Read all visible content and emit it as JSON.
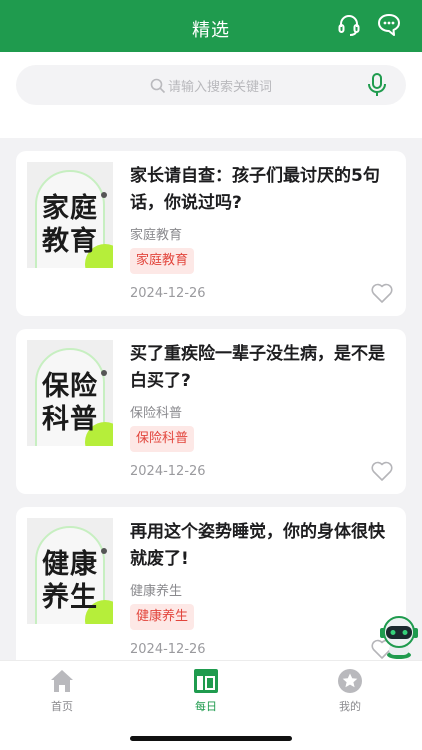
{
  "header": {
    "title": "精选",
    "icons": [
      "headset-icon",
      "chat-icon"
    ],
    "color": "#1f9b4e"
  },
  "search": {
    "placeholder": "请输入搜索关键词",
    "icons": [
      "search-icon",
      "mic-icon"
    ]
  },
  "articles": [
    {
      "thumb_line1": "家庭",
      "thumb_line2": "教育",
      "title": "家长请自查：孩子们最讨厌的5句话，你说过吗?",
      "category": "家庭教育",
      "tag": "家庭教育",
      "date": "2024-12-26"
    },
    {
      "thumb_line1": "保险",
      "thumb_line2": "科普",
      "title": "买了重疾险一辈子没生病，是不是白买了?",
      "category": "保险科普",
      "tag": "保险科普",
      "date": "2024-12-26"
    },
    {
      "thumb_line1": "健康",
      "thumb_line2": "养生",
      "title": "再用这个姿势睡觉，你的身体很快就废了!",
      "category": "健康养生",
      "tag": "健康养生",
      "date": "2024-12-26"
    }
  ],
  "tabs": [
    {
      "label": "首页",
      "icon": "home-icon",
      "active": false
    },
    {
      "label": "每日",
      "icon": "daily-icon",
      "active": true
    },
    {
      "label": "我的",
      "icon": "star-icon",
      "active": false
    }
  ],
  "colors": {
    "accent": "#1f9b4e",
    "tag_bg": "#fde8e6",
    "tag_text": "#e2453c"
  }
}
